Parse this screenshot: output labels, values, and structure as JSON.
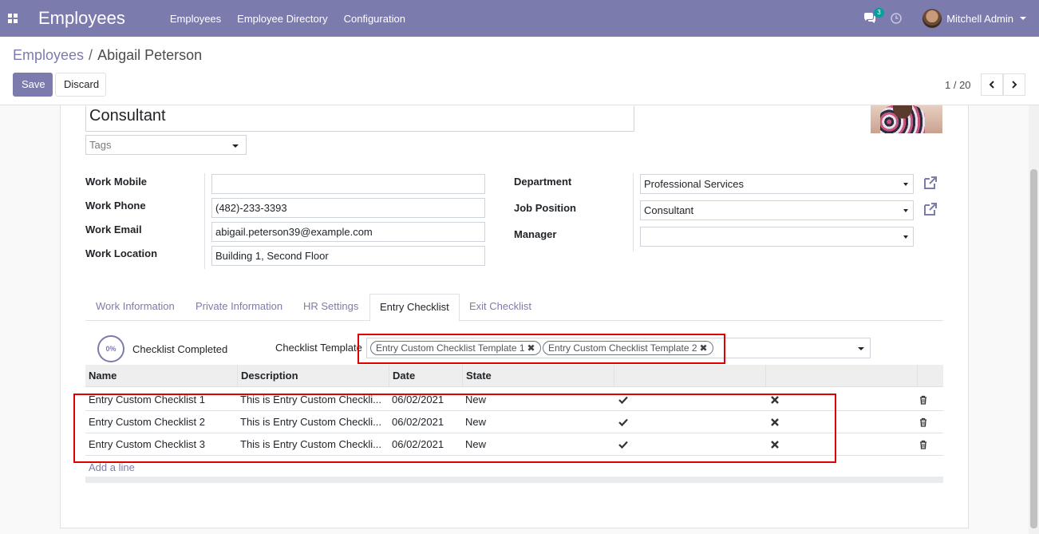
{
  "navbar": {
    "brand": "Employees",
    "menu": [
      "Employees",
      "Employee Directory",
      "Configuration"
    ],
    "chat_badge": "3",
    "user_name": "Mitchell Admin",
    "color": "#7c7bad"
  },
  "breadcrumb": {
    "parent": "Employees",
    "current": "Abigail Peterson"
  },
  "actions": {
    "save": "Save",
    "discard": "Discard"
  },
  "pager": {
    "label": "1 / 20"
  },
  "employee": {
    "job_title": "Consultant",
    "tags_placeholder": "Tags",
    "work_mobile_label": "Work Mobile",
    "work_mobile": "",
    "work_phone_label": "Work Phone",
    "work_phone": "(482)-233-3393",
    "work_email_label": "Work Email",
    "work_email": "abigail.peterson39@example.com",
    "work_location_label": "Work Location",
    "work_location": "Building 1, Second Floor",
    "department_label": "Department",
    "department": "Professional Services",
    "job_position_label": "Job Position",
    "job_position": "Consultant",
    "manager_label": "Manager",
    "manager": ""
  },
  "tabs": [
    "Work Information",
    "Private Information",
    "HR Settings",
    "Entry Checklist",
    "Exit Checklist"
  ],
  "checklist": {
    "progress": "0%",
    "progress_label": "Checklist Completed",
    "template_label": "Checklist Template",
    "templates": [
      "Entry Custom Checklist Template 1",
      "Entry Custom Checklist Template 2"
    ],
    "columns": [
      "Name",
      "Description",
      "Date",
      "State"
    ],
    "rows": [
      {
        "name": "Entry Custom Checklist 1",
        "description": "This is Entry Custom Checkli...",
        "date": "06/02/2021",
        "state": "New"
      },
      {
        "name": "Entry Custom Checklist 2",
        "description": "This is Entry Custom Checkli...",
        "date": "06/02/2021",
        "state": "New"
      },
      {
        "name": "Entry Custom Checklist 3",
        "description": "This is Entry Custom Checkli...",
        "date": "06/02/2021",
        "state": "New"
      }
    ],
    "add_line": "Add a line"
  }
}
